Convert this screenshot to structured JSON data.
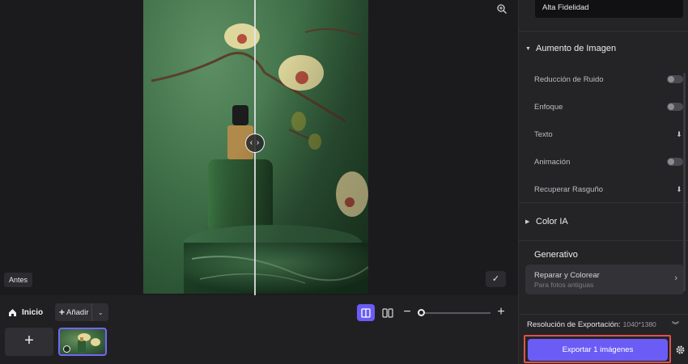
{
  "canvas": {
    "before_label": "Antes"
  },
  "toolbar": {
    "home_label": "Inicio",
    "add_label": "Añadir"
  },
  "panel": {
    "quality_value": "Alta Fidelidad",
    "enhance": {
      "title": "Aumento de Imagen",
      "items": [
        {
          "label": "Reducción de Ruido",
          "control": "toggle",
          "on": false
        },
        {
          "label": "Enfoque",
          "control": "toggle",
          "on": false
        },
        {
          "label": "Texto",
          "control": "download"
        },
        {
          "label": "Animación",
          "control": "toggle",
          "on": false
        },
        {
          "label": "Recuperar Rasguño",
          "control": "download"
        }
      ]
    },
    "color_ai_title": "Color IA",
    "generative": {
      "title": "Generativo",
      "repair_title": "Reparar y Colorear",
      "repair_subtitle": "Para fotos antiguas"
    },
    "export": {
      "resolution_label": "Resolución de Exportación:",
      "resolution_value": "1040*1380",
      "button_label": "Exportar 1 imágenes"
    }
  },
  "colors": {
    "accent": "#6b5cf6",
    "highlight": "#e0524a",
    "panel_bg": "#242427"
  }
}
